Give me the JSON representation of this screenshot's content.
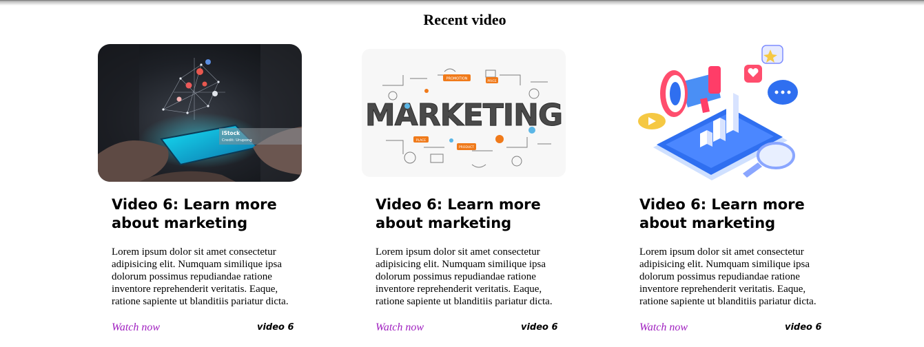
{
  "section": {
    "title": "Recent video"
  },
  "cards": [
    {
      "title": "Video 6: Learn more about marketing",
      "description": "Lorem ipsum dolor sit amet consectetur adipisicing elit. Numquam similique ipsa dolorum possimus repudiandae ratione inventore reprehenderit veritatis. Eaque, ratione sapiente ut blanditiis pariatur dicta.",
      "link_label": "Watch now",
      "tag": "video 6",
      "image": {
        "kind": "photo-hands-smartphone-social-icons",
        "watermark": "iStock",
        "credit": "Credit: Urupong"
      }
    },
    {
      "title": "Video 6: Learn more about marketing",
      "description": "Lorem ipsum dolor sit amet consectetur adipisicing elit. Numquam similique ipsa dolorum possimus repudiandae ratione inventore reprehenderit veritatis. Eaque, ratione sapiente ut blanditiis pariatur dicta.",
      "link_label": "Watch now",
      "tag": "video 6",
      "image": {
        "kind": "marketing-doodle-illustration",
        "word": "MARKETING",
        "chips": [
          "PROMOTION",
          "PRICE",
          "PLACE",
          "PRODUCT"
        ]
      }
    },
    {
      "title": "Video 6: Learn more about marketing",
      "description": "Lorem ipsum dolor sit amet consectetur adipisicing elit. Numquam similique ipsa dolorum possimus repudiandae ratione inventore reprehenderit veritatis. Eaque, ratione sapiente ut blanditiis pariatur dicta.",
      "link_label": "Watch now",
      "tag": "video 6",
      "image": {
        "kind": "isometric-megaphone-tablet-illustration"
      }
    }
  ],
  "colors": {
    "link": "#a020c0",
    "title": "#000000",
    "marketing_orange": "#f07a1a",
    "iso_blue": "#2f6ff0"
  }
}
